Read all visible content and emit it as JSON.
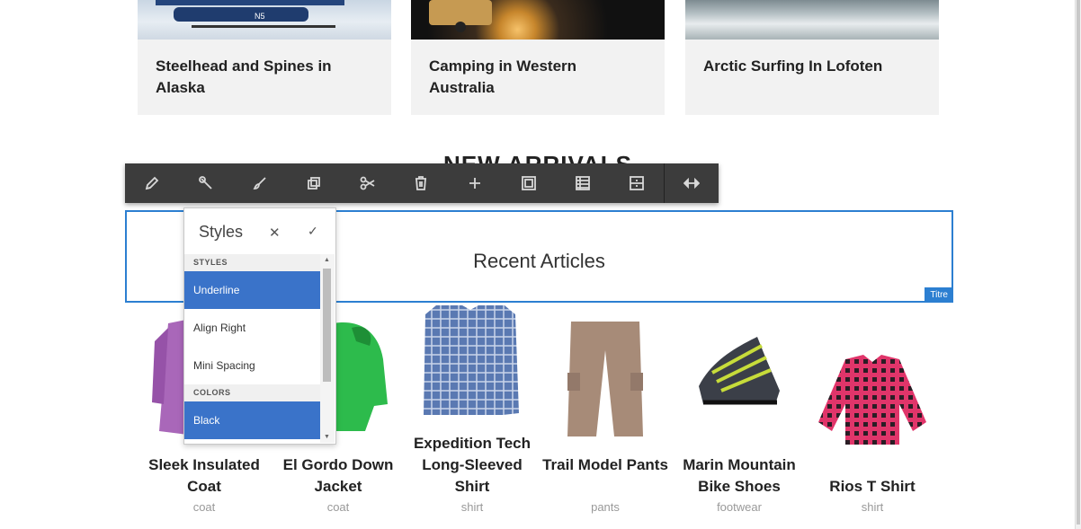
{
  "articles": [
    {
      "title": "Steelhead and Spines in Alaska",
      "image": "snow-plane"
    },
    {
      "title": "Camping in Western Australia",
      "image": "campfire-night"
    },
    {
      "title": "Arctic Surfing In Lofoten",
      "image": "sea-waves"
    }
  ],
  "section_heading": "NEW ARRIVALS",
  "toolbar": {
    "buttons": [
      {
        "icon": "pencil-icon"
      },
      {
        "icon": "wrench-icon"
      },
      {
        "icon": "paintbrush-icon"
      },
      {
        "icon": "copy-icon"
      },
      {
        "icon": "scissors-icon"
      },
      {
        "icon": "trash-icon"
      },
      {
        "icon": "plus-icon"
      },
      {
        "icon": "group-icon"
      },
      {
        "icon": "table-icon"
      },
      {
        "icon": "layout-icon"
      },
      {
        "icon": "resize-horizontal-icon"
      }
    ]
  },
  "component": {
    "title": "Recent Articles",
    "tag": "Titre",
    "accent": "#2c7fd1"
  },
  "styles_popover": {
    "title": "Styles",
    "close": "✕",
    "confirm": "✓",
    "groups": [
      {
        "label": "STYLES",
        "options": [
          {
            "label": "Underline",
            "selected": true
          },
          {
            "label": "Align Right",
            "selected": false
          },
          {
            "label": "Mini Spacing",
            "selected": false
          }
        ]
      },
      {
        "label": "COLORS",
        "options": [
          {
            "label": "Black",
            "selected": true
          }
        ]
      }
    ],
    "selected_color": "#3a73c9"
  },
  "products": [
    {
      "name": "Sleek Insulated Coat",
      "category": "coat",
      "image": "purple-coat"
    },
    {
      "name": "El Gordo Down Jacket",
      "category": "coat",
      "image": "green-jacket"
    },
    {
      "name": "Expedition Tech Long-Sleeved Shirt",
      "category": "shirt",
      "image": "plaid-shirt"
    },
    {
      "name": "Trail Model Pants",
      "category": "pants",
      "image": "cargo-pants"
    },
    {
      "name": "Marin Mountain Bike Shoes",
      "category": "footwear",
      "image": "bike-shoes"
    },
    {
      "name": "Rios T Shirt",
      "category": "shirt",
      "image": "pink-flannel"
    }
  ]
}
